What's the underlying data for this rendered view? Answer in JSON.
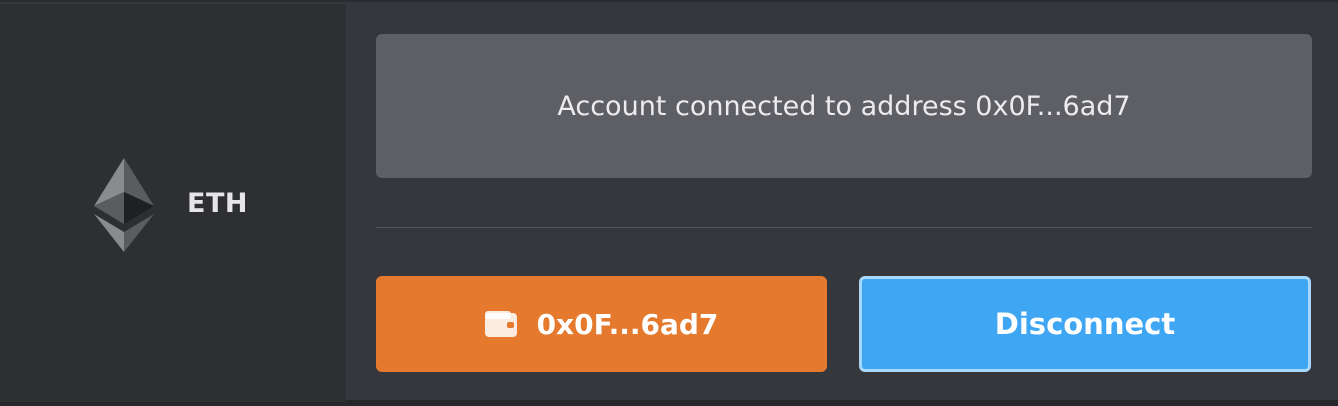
{
  "network": {
    "icon": "ethereum-logo-icon",
    "label": "ETH"
  },
  "status": {
    "message": "Account connected to address 0x0F...6ad7"
  },
  "actions": {
    "address_button_icon": "wallet-icon",
    "address_button_label": "0x0F...6ad7",
    "disconnect_label": "Disconnect"
  },
  "colors": {
    "address_button_bg": "#e57a2f",
    "disconnect_button_bg": "#3fa6f4",
    "status_box_bg": "#5e5f64",
    "sidebar_bg": "#2e2f33",
    "main_bg": "#36373c"
  }
}
